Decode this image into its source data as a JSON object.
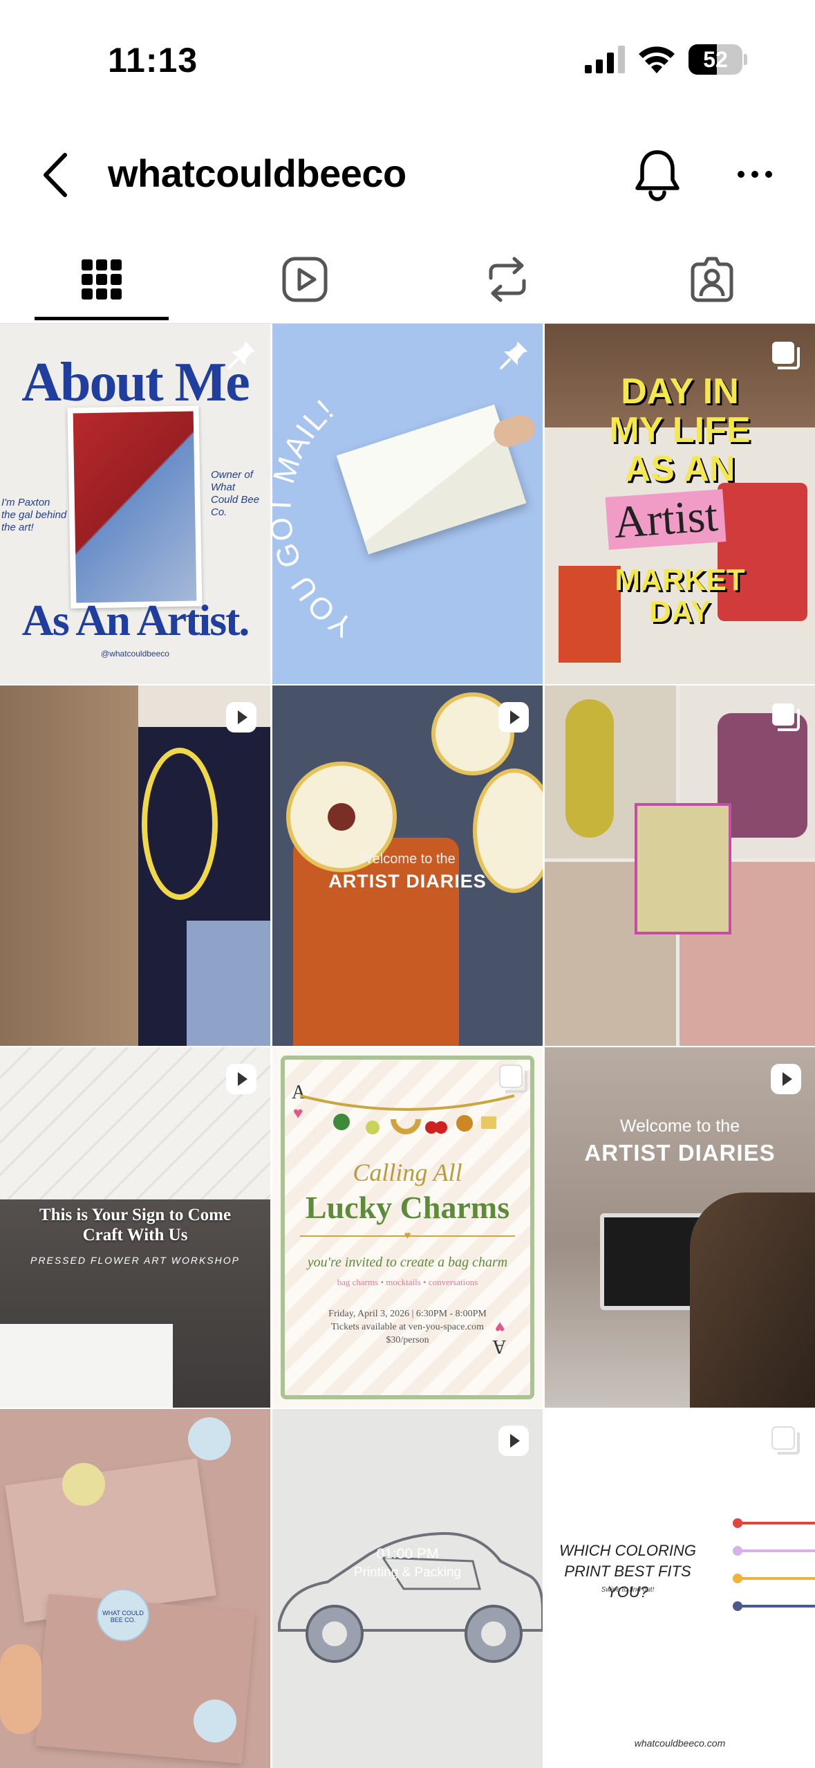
{
  "status_bar": {
    "time": "11:13",
    "battery_level": "52",
    "battery_fraction": 0.52
  },
  "header": {
    "back_icon": "chevron-left-icon",
    "username": "whatcouldbeeco",
    "notification_icon": "bell-icon",
    "more_icon": "ellipsis-icon"
  },
  "tabs": [
    {
      "icon": "grid-icon",
      "active": true
    },
    {
      "icon": "reels-icon",
      "active": false
    },
    {
      "icon": "reposts-icon",
      "active": false
    },
    {
      "icon": "tagged-icon",
      "active": false
    }
  ],
  "posts": {
    "p1": {
      "line1": "About Me",
      "line2": "As An Artist.",
      "note_left": "I'm Paxton the gal behind the art!",
      "note_right": "Owner of What Could Bee Co.",
      "handle": "@whatcouldbeeco",
      "badge": "pin-icon"
    },
    "p2": {
      "text": "YOU GOT MAIL!",
      "badge": "pin-icon"
    },
    "p3": {
      "line1": "DAY IN",
      "line2": "MY LIFE",
      "line3": "AS AN",
      "line4": "Artist",
      "line5": "MARKET",
      "line6": "DAY",
      "badge": "carousel-icon"
    },
    "p4": {
      "badge": "reel-icon"
    },
    "p5": {
      "line1": "Welcome to the",
      "line2": "ARTIST DIARIES",
      "badge": "reel-icon"
    },
    "p6": {
      "badge": "carousel-icon"
    },
    "p7": {
      "line1": "This is Your Sign to Come",
      "line2": "Craft With Us",
      "line3": "PRESSED FLOWER ART WORKSHOP",
      "badge": "reel-icon"
    },
    "p8": {
      "card_letter": "A",
      "line1": "Calling All",
      "line2": "Lucky Charms",
      "line3": "you're invited to create a bag charm",
      "line4": "bag charms • mocktails • conversations",
      "line5": "Friday, April 3, 2026 | 6:30PM - 8:00PM",
      "line6": "Tickets available at ven-you-space.com",
      "line7": "$30/person",
      "badge": "carousel-icon"
    },
    "p9": {
      "line1": "Welcome to the",
      "line2": "ARTIST DIARIES",
      "badge": "reel-icon"
    },
    "p10": {
      "stamp": "WHAT COULD BEE CO.",
      "badge": "none"
    },
    "p11": {
      "line1": "01:00 PM",
      "line2": "Printing & Packing",
      "badge": "reel-icon"
    },
    "p12": {
      "line1": "WHICH COLORING",
      "line2": "PRINT BEST FITS YOU?",
      "line3": "Swipe to find out!",
      "footer": "whatcouldbeeco.com",
      "badge": "carousel-icon"
    }
  }
}
